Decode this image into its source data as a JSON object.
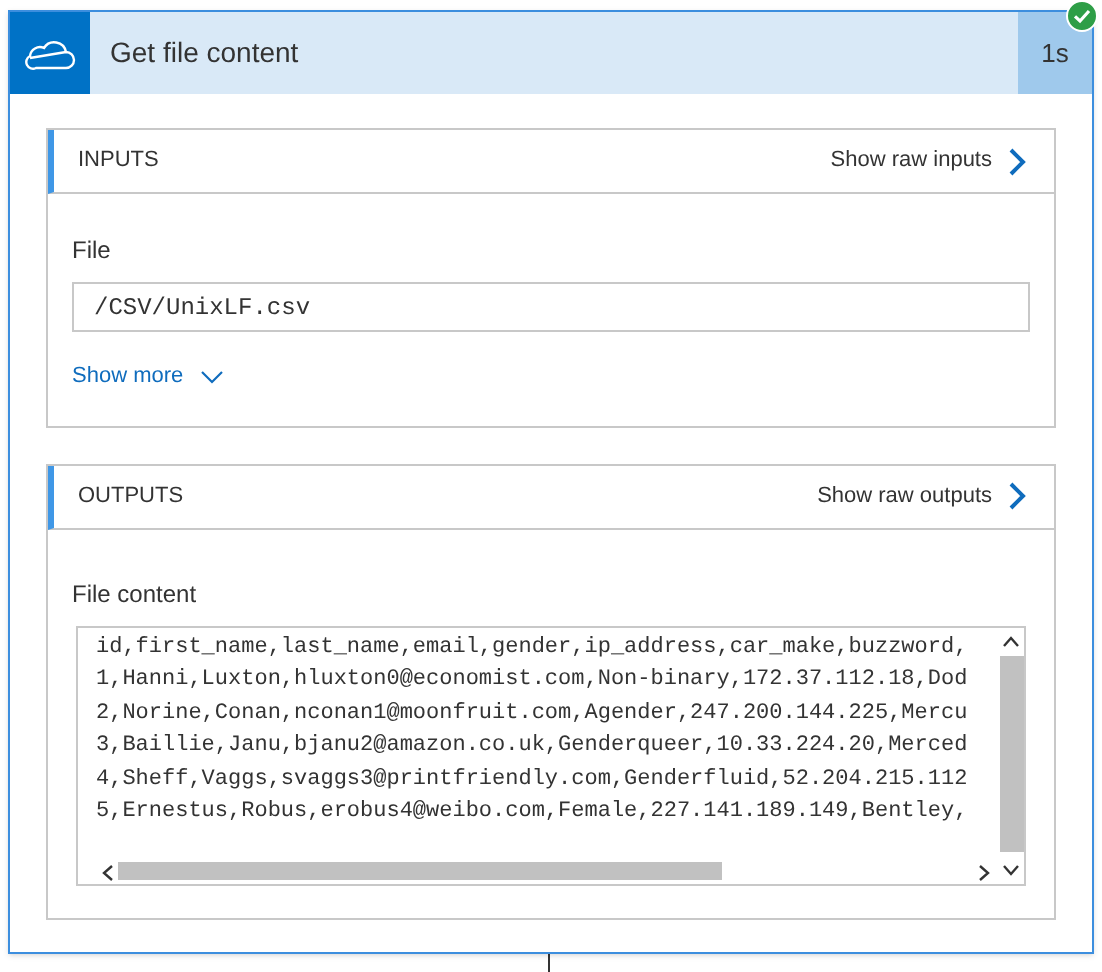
{
  "card": {
    "title": "Get file content",
    "duration": "1s",
    "succeeded": true
  },
  "inputs": {
    "heading": "INPUTS",
    "raw_link": "Show raw inputs",
    "fields": [
      {
        "label": "File",
        "value": "/CSV/UnixLF.csv"
      }
    ],
    "show_more": "Show more"
  },
  "outputs": {
    "heading": "OUTPUTS",
    "raw_link": "Show raw outputs",
    "field_label": "File content",
    "lines": [
      "id,first_name,last_name,email,gender,ip_address,car_make,buzzword,",
      "1,Hanni,Luxton,hluxton0@economist.com,Non-binary,172.37.112.18,Dod",
      "2,Norine,Conan,nconan1@moonfruit.com,Agender,247.200.144.225,Mercu",
      "3,Baillie,Janu,bjanu2@amazon.co.uk,Genderqueer,10.33.224.20,Merced",
      "4,Sheff,Vaggs,svaggs3@printfriendly.com,Genderfluid,52.204.215.112",
      "5,Ernestus,Robus,erobus4@weibo.com,Female,227.141.189.149,Bentley,"
    ]
  }
}
